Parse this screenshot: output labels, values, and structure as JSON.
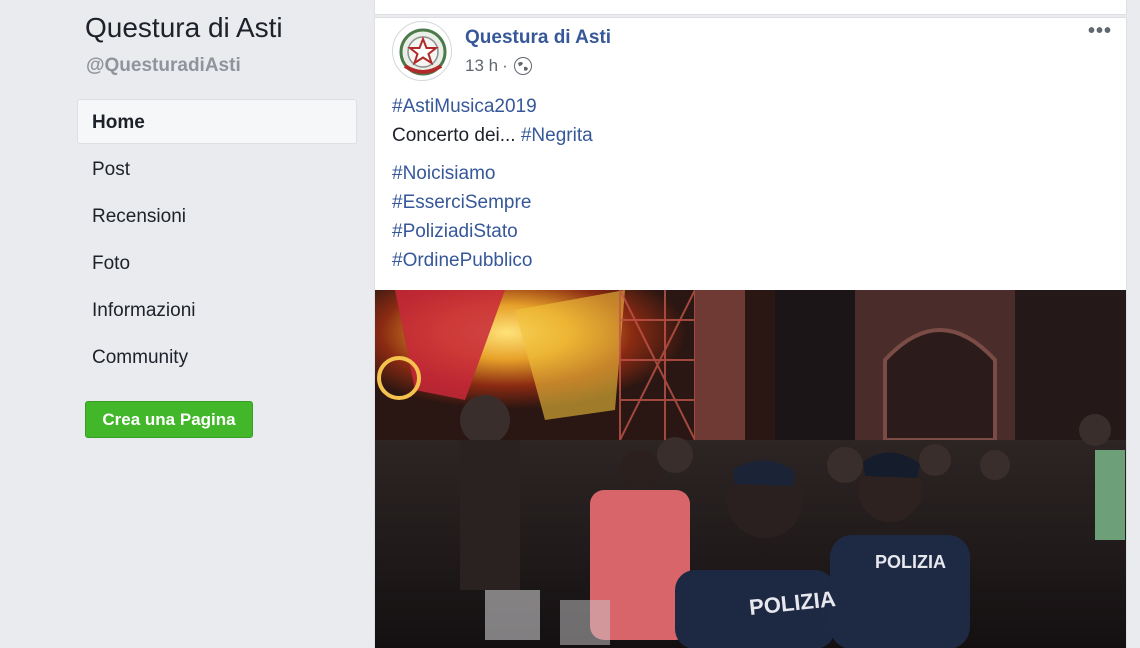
{
  "sidebar": {
    "page_name": "Questura di Asti",
    "page_handle": "@QuesturadiAsti",
    "items": [
      {
        "label": "Home"
      },
      {
        "label": "Post"
      },
      {
        "label": "Recensioni"
      },
      {
        "label": "Foto"
      },
      {
        "label": "Informazioni"
      },
      {
        "label": "Community"
      }
    ],
    "create_label": "Crea una Pagina",
    "create_color": "#42b72a"
  },
  "post": {
    "author": "Questura di Asti",
    "time": "13 h",
    "separator": "·",
    "privacy_icon": "globe-icon",
    "more_label": "•••",
    "hashtag1": "#AstiMusica2019",
    "line2_text": "Concerto dei... ",
    "line2_tag": "#Negrita",
    "tags": [
      "#Noicisiamo",
      "#EsserciSempre",
      "#PoliziadiStato",
      "#OrdinePubblico"
    ],
    "photo_labels": [
      "POLIZIA",
      "POLIZIA"
    ],
    "link_color": "#365899"
  }
}
